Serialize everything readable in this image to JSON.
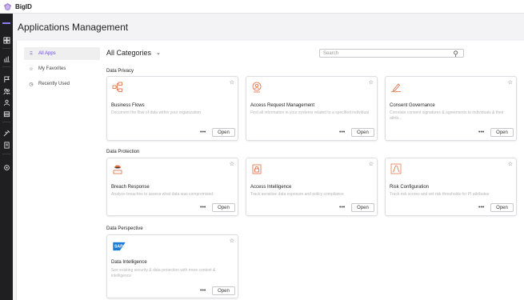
{
  "brand": {
    "name": "BigID"
  },
  "page": {
    "title": "Applications Management"
  },
  "left_nav": [
    {
      "label": "All Apps",
      "icon": "grid-icon"
    },
    {
      "label": "My Favorites",
      "icon": "star-icon"
    },
    {
      "label": "Recently Used",
      "icon": "clock-icon"
    }
  ],
  "filter": {
    "category": "All Categories"
  },
  "search": {
    "placeholder": "Search"
  },
  "sections": {
    "privacy": "Data Privacy",
    "protection": "Data Protection",
    "perspective": "Data Perspective"
  },
  "cards": {
    "business_flows": {
      "title": "Business Flows",
      "desc": "Document the flow of data within your organization",
      "open": "Open",
      "more": "•••"
    },
    "access_request": {
      "title": "Access Request Management",
      "desc": "Find all information in your systems related to a specified individual",
      "open": "Open",
      "more": "•••"
    },
    "consent": {
      "title": "Consent Governance",
      "desc": "Correlate consent signatures & agreements to individuals & their attrib...",
      "open": "Open",
      "more": "•••"
    },
    "breach": {
      "title": "Breach Response",
      "desc": "Analyze breaches to assess what data was compromised",
      "open": "Open",
      "more": "•••"
    },
    "access_intel": {
      "title": "Access Intelligence",
      "desc": "Track sensitive data exposure and policy compliance",
      "open": "Open",
      "more": "•••"
    },
    "risk": {
      "title": "Risk Configuration",
      "desc": "Track risk scores and set risk thresholds for PI attributes",
      "open": "Open",
      "more": "•••"
    },
    "data_intel": {
      "title": "Data Intelligence",
      "desc": "See existing security & data protection with more context & intelligence",
      "open": "Open",
      "more": "•••",
      "logo_text": "SAP"
    }
  },
  "colors": {
    "accent": "#6a4fd8",
    "sidebar": "#1f1f22",
    "logo_orange": "#e0693a"
  }
}
